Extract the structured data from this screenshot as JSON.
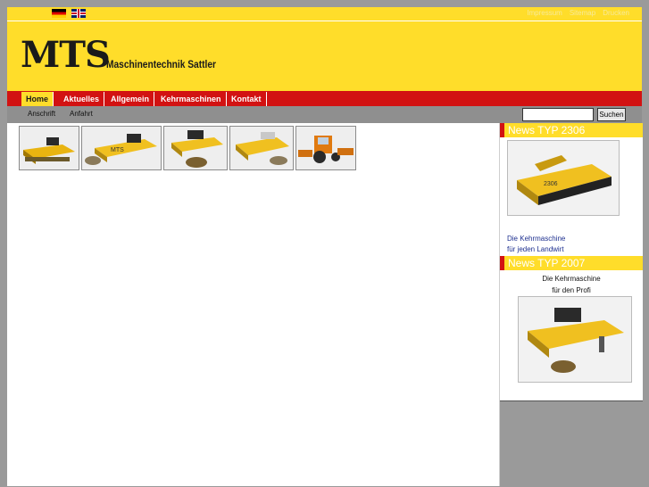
{
  "topbar": {
    "flags": [
      "flag-de-icon",
      "flag-uk-icon"
    ],
    "links": [
      "Impressum",
      "Sitemap",
      "Drucken"
    ]
  },
  "header": {
    "logo": "MTS",
    "subtitle": "Maschinentechnik Sattler"
  },
  "nav": {
    "items": [
      {
        "label": "Home",
        "active": true
      },
      {
        "label": "Aktuelles",
        "active": false
      },
      {
        "label": "Allgemein",
        "active": false
      },
      {
        "label": "Kehrmaschinen",
        "active": false
      },
      {
        "label": "Kontakt",
        "active": false
      }
    ]
  },
  "subnav": {
    "items": [
      "Anschrift",
      "Anfahrt"
    ]
  },
  "search": {
    "value": "",
    "button_label": "Suchen"
  },
  "thumbnails": [
    "sweeper-thumbnail",
    "sweeper-thumbnail",
    "sweeper-thumbnail",
    "sweeper-thumbnail",
    "tractor-sweeper-thumbnail"
  ],
  "sidebar": {
    "news1": {
      "title": "News TYP 2306",
      "line1": "Die Kehrmaschine",
      "line2": "für jeden Landwirt"
    },
    "news2": {
      "title": "News TYP 2007",
      "line1": "Die Kehrmaschine",
      "line2": "für den Profi"
    }
  },
  "colors": {
    "brand_yellow": "#ffdd2a",
    "nav_red": "#d21212",
    "subnav_gray": "#8f8f8f",
    "background_gray": "#9a9a9a"
  }
}
